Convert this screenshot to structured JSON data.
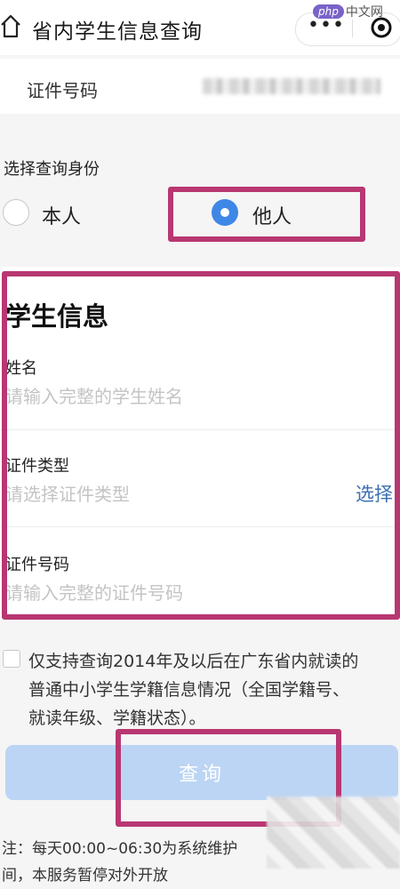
{
  "header": {
    "title": "省内学生信息查询",
    "watermark_logo": "php",
    "watermark_text": "中文网",
    "more_icon": "more-dots-icon",
    "close_icon": "target-circle-icon"
  },
  "id_row": {
    "label": "证件号码"
  },
  "identity": {
    "label": "选择查询身份",
    "options": [
      "本人",
      "他人"
    ],
    "selected": "他人"
  },
  "student": {
    "title": "学生信息",
    "fields": [
      {
        "label": "姓名",
        "placeholder": "请输入完整的学生姓名"
      },
      {
        "label": "证件类型",
        "placeholder": "请选择证件类型",
        "action": "选择"
      },
      {
        "label": "证件号码",
        "placeholder": "请输入完整的证件号码"
      }
    ]
  },
  "notice": {
    "line1": "仅支持查询2014年及以后在广东省内就读的",
    "line2": "普通中小学生学籍信息情况（全国学籍号、",
    "line3": "就读年级、学籍状态）。"
  },
  "query_button": "查询",
  "footnote": {
    "line1": "注：每天00:00~06:30为系统维护",
    "line2": "间，本服务暂停对外开放"
  },
  "colors": {
    "accent": "#3f87e6",
    "highlight": "#b83771",
    "button_disabled": "#bcd5f4",
    "link": "#3b6fb0"
  }
}
